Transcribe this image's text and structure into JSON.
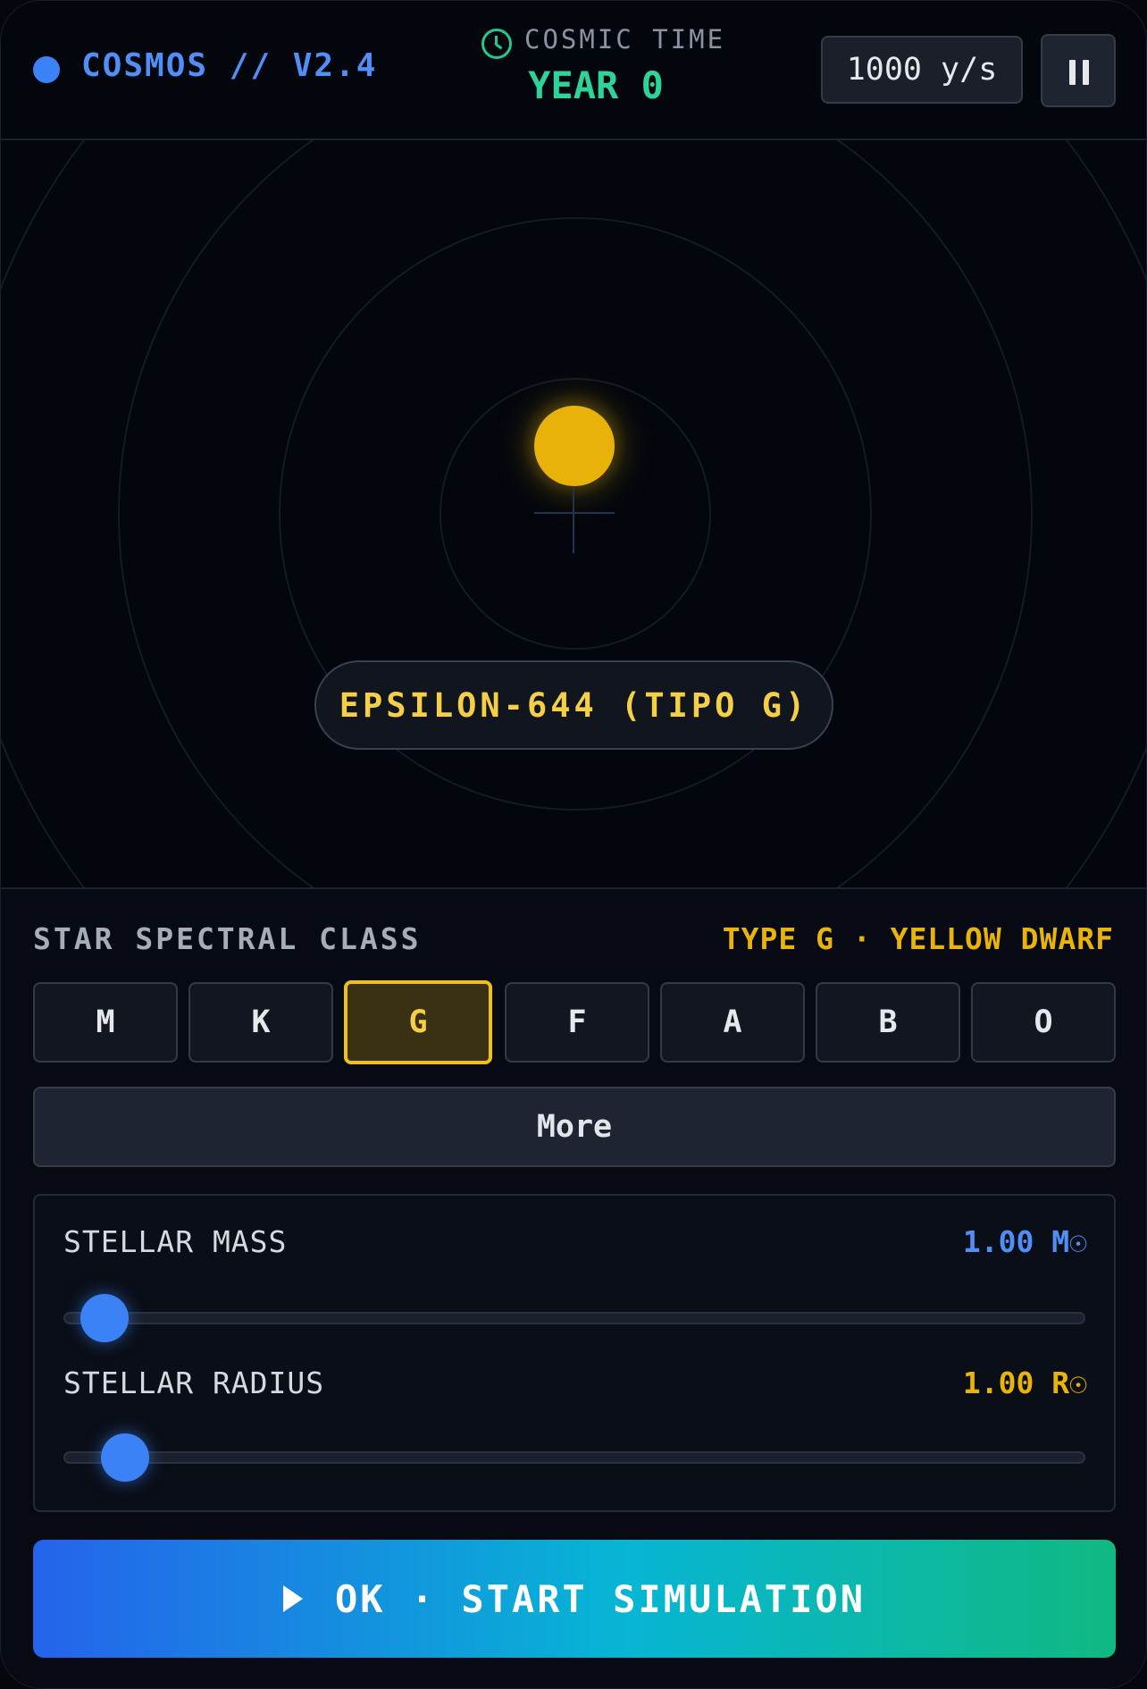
{
  "header": {
    "brand": "COSMOS // V2.4",
    "cosmic_label": "COSMIC TIME",
    "year": "YEAR 0",
    "speed": "1000 y/s"
  },
  "viewport": {
    "star_name": "EPSILON-644 (TIPO G)"
  },
  "spectral": {
    "title": "STAR SPECTRAL CLASS",
    "description": "TYPE G · YELLOW DWARF",
    "classes": [
      "M",
      "K",
      "G",
      "F",
      "A",
      "B",
      "O"
    ],
    "selected": "G",
    "more_label": "More"
  },
  "params": {
    "mass": {
      "label": "STELLAR MASS",
      "value": "1.00 M☉",
      "fraction": 0.03,
      "color": "#4f8ff7"
    },
    "radius": {
      "label": "STELLAR RADIUS",
      "value": "1.00 R☉",
      "fraction": 0.05,
      "color": "#eab308"
    }
  },
  "actions": {
    "start_label": "OK · START SIMULATION"
  },
  "colors": {
    "accent": "#3b82f6",
    "time": "#2ed39a",
    "star": "#e8b209",
    "highlight": "#f2c014"
  },
  "icons": [
    "brand-dot-icon",
    "clock-icon",
    "pause-icon",
    "play-icon"
  ]
}
